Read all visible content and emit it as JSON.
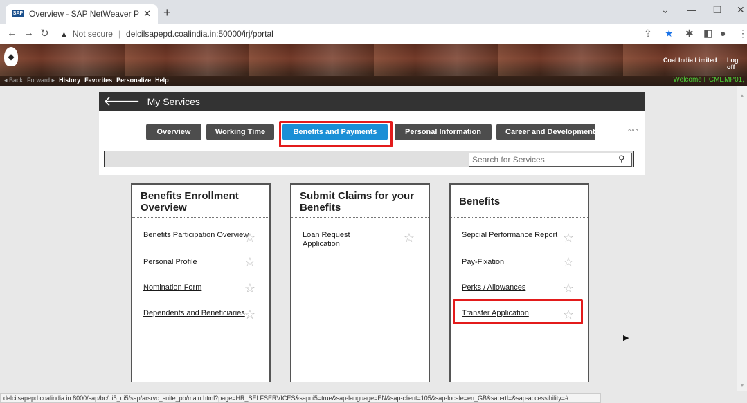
{
  "browser": {
    "tab_title": "Overview - SAP NetWeaver Porta",
    "tab_favicon": "SAP",
    "url_security": "Not secure",
    "url": "delcilsapepd.coalindia.in:50000/irj/portal"
  },
  "portal": {
    "nav_back": "◂ Back",
    "nav_forward": "Forward ▸",
    "nav_items": [
      "History",
      "Favorites",
      "Personalize",
      "Help"
    ],
    "company_link": "Coal India Limited",
    "logoff_link": "Log off",
    "welcome": "Welcome HCMEMP01,"
  },
  "services": {
    "title": "My Services",
    "tabs": [
      {
        "label": "Overview"
      },
      {
        "label": "Working Time"
      },
      {
        "label": "Benefits and Payments",
        "active": true
      },
      {
        "label": "Personal Information"
      },
      {
        "label": "Career and Development"
      }
    ],
    "more": "∘∘∘",
    "search_placeholder": "Search for Services"
  },
  "cards": [
    {
      "title": "Benefits Enrollment Overview",
      "items": [
        "Benefits Participation Overview",
        "Personal Profile",
        "Nomination Form",
        "Dependents and Beneficiaries"
      ]
    },
    {
      "title": "Submit Claims for your Benefits",
      "items": [
        "Loan Request Application"
      ]
    },
    {
      "title": "Benefits",
      "items": [
        "Sepcial Performance Report",
        "Pay-Fixation",
        "Perks / Allowances",
        "Transfer Application"
      ]
    }
  ],
  "status_url": "delcilsapepd.coalindia.in:8000/sap/bc/ui5_ui5/sap/arsrvc_suite_pb/main.html?page=HR_SELFSERVICES&sapui5=true&sap-language=EN&sap-client=105&sap-locale=en_GB&sap-rtl=&sap-accessibility=#",
  "colors": {
    "active_tab": "#1a8fd6",
    "highlight": "#e31b1b",
    "welcome": "#4cd137"
  }
}
